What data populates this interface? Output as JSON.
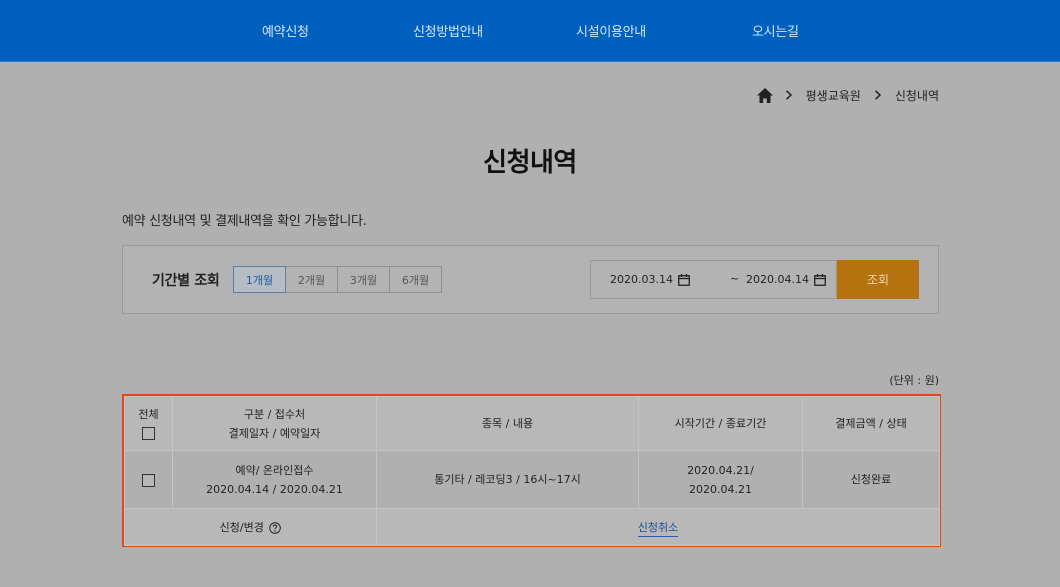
{
  "nav": {
    "items": [
      {
        "label": "예약신청"
      },
      {
        "label": "신청방법안내"
      },
      {
        "label": "시설이용안내"
      },
      {
        "label": "오시는길"
      }
    ]
  },
  "breadcrumb": {
    "items": [
      {
        "label": "평생교육원"
      },
      {
        "label": "신청내역"
      }
    ]
  },
  "page": {
    "title": "신청내역",
    "description": "예약 신청내역 및 결제내역을 확인 가능합니다."
  },
  "filter": {
    "label": "기간별 조회",
    "periods": [
      {
        "label": "1개월",
        "active": true
      },
      {
        "label": "2개월",
        "active": false
      },
      {
        "label": "3개월",
        "active": false
      },
      {
        "label": "6개월",
        "active": false
      }
    ],
    "date_from": "2020.03.14",
    "date_separator": "~",
    "date_to": "2020.04.14",
    "search_label": "조회"
  },
  "unit_note": "(단위 : 원)",
  "table": {
    "headers": {
      "select_all": "전체",
      "category_line1": "구분 / 접수처",
      "category_line2": "결제일자 / 예약일자",
      "item": "종목 / 내용",
      "period": "시작기간 / 종료기간",
      "payment": "결제금액 / 상태"
    },
    "rows": [
      {
        "category_line1": "예약/ 온라인접수",
        "category_line2": "2020.04.14 / 2020.04.21",
        "item": "통기타 / 레코딩3 / 16시~17시",
        "period_line1": "2020.04.21/",
        "period_line2": "2020.04.21",
        "payment": "신청완료"
      }
    ],
    "footer": {
      "change_label": "신청/변경",
      "cancel_label": "신청취소"
    }
  },
  "colors": {
    "nav_bg": "#0060bd",
    "search_button": "#b5720e",
    "highlight_border": "#e2461a",
    "link": "#1f4f9a"
  }
}
